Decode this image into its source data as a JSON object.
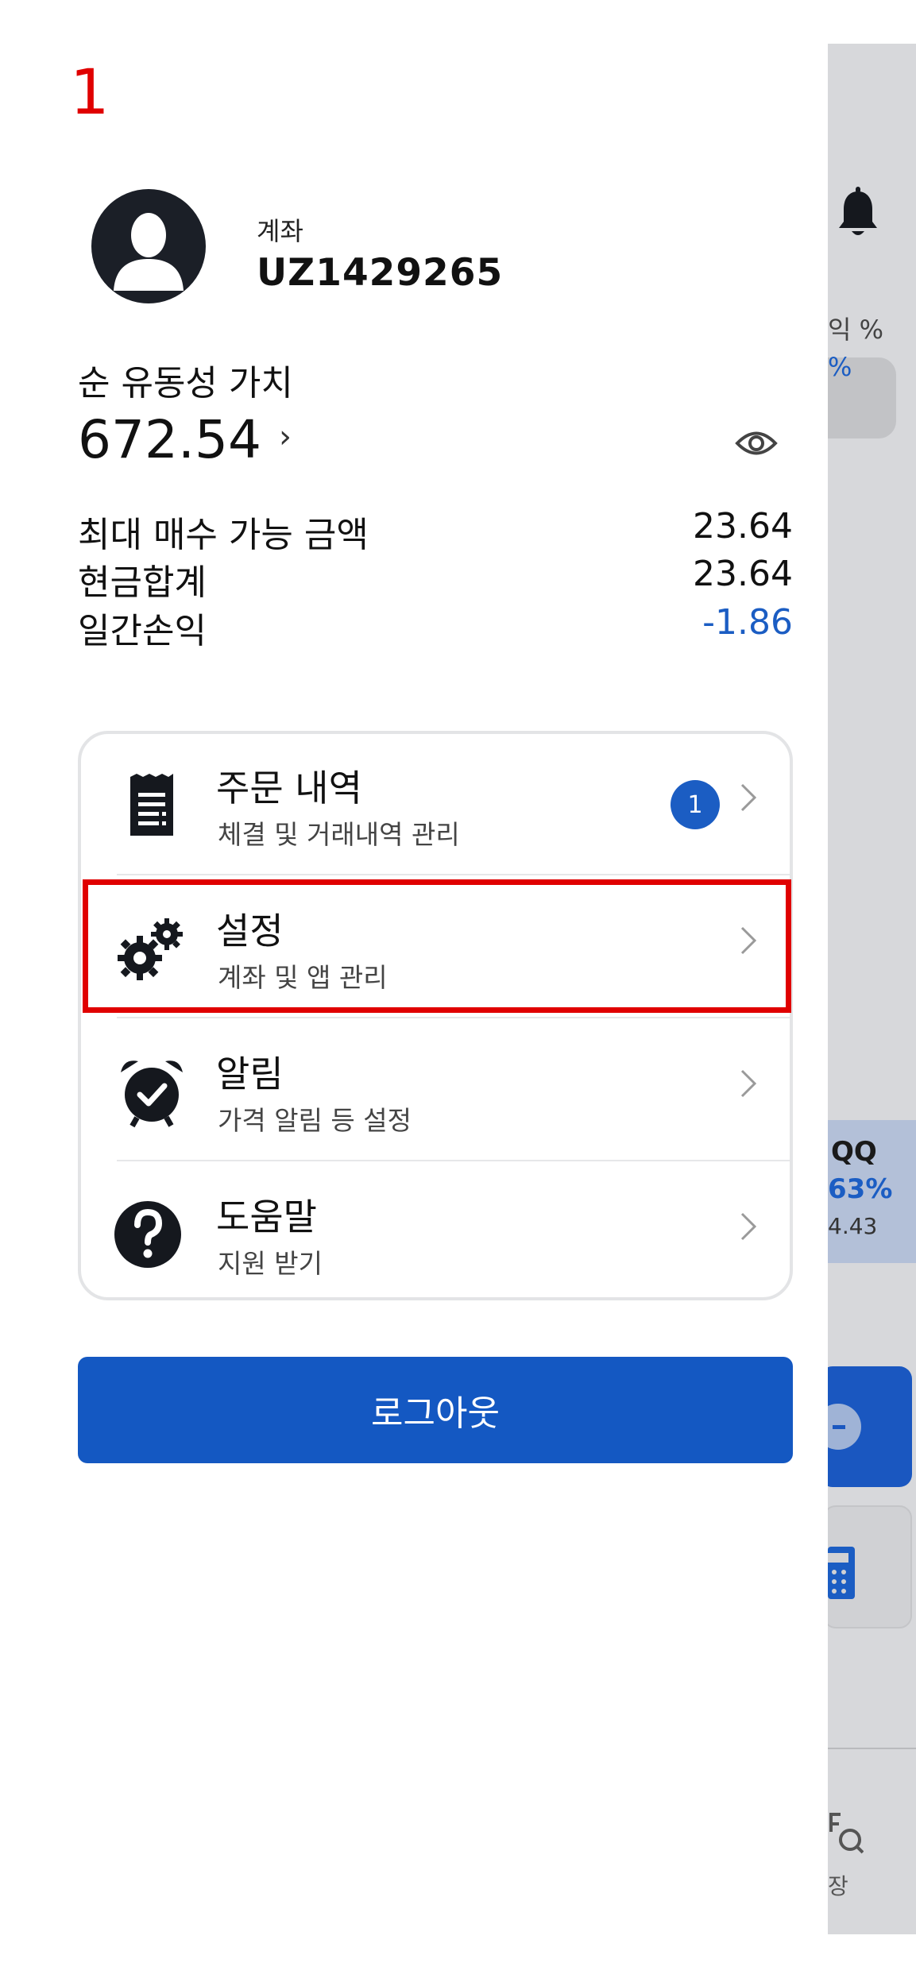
{
  "annotation": {
    "step_number": "1"
  },
  "account": {
    "label": "계좌",
    "id": "UZ1429265"
  },
  "net_liquidation": {
    "label": "순 유동성 가치",
    "value": "672.54",
    "chevron": "›"
  },
  "summary": [
    {
      "label": "최대 매수 가능 금액",
      "value": "23.64"
    },
    {
      "label": "현금합계",
      "value": "23.64"
    },
    {
      "label": "일간손익",
      "value": "-1.86"
    }
  ],
  "menu": {
    "items": [
      {
        "title": "주문 내역",
        "subtitle": "체결 및 거래내역 관리",
        "icon": "receipt-icon",
        "badge": "1"
      },
      {
        "title": "설정",
        "subtitle": "계좌 및 앱 관리",
        "icon": "gears-icon"
      },
      {
        "title": "알림",
        "subtitle": "가격 알림 등 설정",
        "icon": "alarm-clock-icon"
      },
      {
        "title": "도움말",
        "subtitle": "지원 받기",
        "icon": "help-icon"
      }
    ]
  },
  "logout": {
    "label": "로그아웃"
  },
  "background": {
    "col_label": "익 %",
    "col_blue": "%",
    "ticker_partial": "QQ",
    "ticker_pct": "63%",
    "ticker_val": "4.43",
    "market_label": "장"
  },
  "colors": {
    "accent_blue": "#1458c2",
    "negative": "#1b5dc3",
    "highlight": "#e00000"
  }
}
